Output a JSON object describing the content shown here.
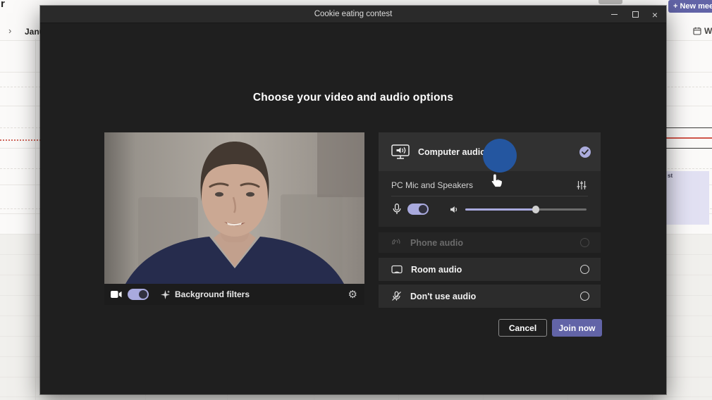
{
  "background_app": {
    "calendar_heading_partial": "r",
    "month_label_partial": "Janu",
    "new_meeting_label": "+ New mee",
    "view_selector_partial": "W",
    "event_block_text_partial": "st"
  },
  "dialog": {
    "title": "Cookie eating contest",
    "window_controls": {
      "close_glyph": "×"
    },
    "heading": "Choose your video and audio options",
    "video_preview": {
      "camera_on": true,
      "background_filters_label": "Background filters",
      "gear_icon_glyph": "⚙"
    },
    "audio_options": {
      "computer_audio": {
        "label": "Computer audio",
        "selected": true
      },
      "device": {
        "label": "PC Mic and Speakers",
        "mic_on": true,
        "volume_percent": 58
      },
      "phone_audio": {
        "label": "Phone audio",
        "disabled": true
      },
      "room_audio": {
        "label": "Room audio",
        "selected": false
      },
      "no_audio": {
        "label": "Don't use audio",
        "selected": false
      }
    },
    "actions": {
      "cancel": "Cancel",
      "join": "Join now"
    }
  },
  "colors": {
    "accent_purple": "#6264a7",
    "toggle_lavender": "#a9aade",
    "annotation_circle_blue": "#2456a0",
    "event_block_lavender": "#e2e1f3",
    "time_indicator_red": "#d0564a"
  }
}
